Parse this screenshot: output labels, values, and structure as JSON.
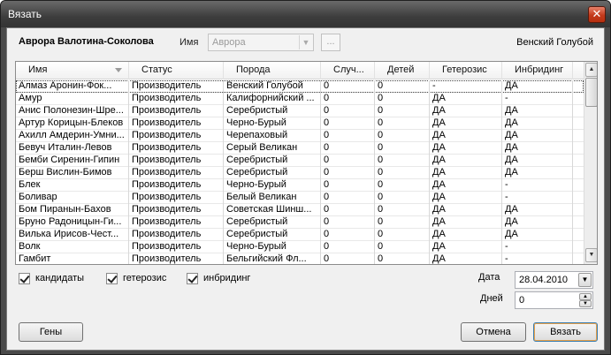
{
  "window": {
    "title": "Вязать",
    "close_symbol": "✕"
  },
  "header": {
    "producer_name": "Аврора Валотина-Соколова",
    "name_label": "Имя",
    "name_value": "Аврора",
    "browse_label": "...",
    "breed": "Венский Голубой"
  },
  "grid": {
    "columns": [
      "Имя",
      "Статус",
      "Порода",
      "Случ...",
      "Детей",
      "Гетерозис",
      "Инбридинг"
    ],
    "rows": [
      [
        "Алмаз Аронин-Фок...",
        "Производитель",
        "Венский Голубой",
        "0",
        "0",
        "-",
        "ДА"
      ],
      [
        "Амур",
        "Производитель",
        "Калифорнийский ...",
        "0",
        "0",
        "ДА",
        "-"
      ],
      [
        "Анис Полонезин-Шре...",
        "Производитель",
        "Серебристый",
        "0",
        "0",
        "ДА",
        "ДА"
      ],
      [
        "Артур Корицын-Блеков",
        "Производитель",
        "Черно-Бурый",
        "0",
        "0",
        "ДА",
        "ДА"
      ],
      [
        "Ахилл Амдерин-Умни...",
        "Производитель",
        "Черепаховый",
        "0",
        "0",
        "ДА",
        "ДА"
      ],
      [
        "Бевуч Италин-Левов",
        "Производитель",
        "Серый Великан",
        "0",
        "0",
        "ДА",
        "ДА"
      ],
      [
        "Бемби Сиренин-Гипин",
        "Производитель",
        "Серебристый",
        "0",
        "0",
        "ДА",
        "ДА"
      ],
      [
        "Берш Вислин-Бимов",
        "Производитель",
        "Серебристый",
        "0",
        "0",
        "ДА",
        "ДА"
      ],
      [
        "Блек",
        "Производитель",
        "Черно-Бурый",
        "0",
        "0",
        "ДА",
        "-"
      ],
      [
        "Боливар",
        "Производитель",
        "Белый Великан",
        "0",
        "0",
        "ДА",
        "-"
      ],
      [
        "Бом Пиранын-Бахов",
        "Производитель",
        "Советская Шинш...",
        "0",
        "0",
        "ДА",
        "ДА"
      ],
      [
        "Бруно Радоницын-Ги...",
        "Производитель",
        "Серебристый",
        "0",
        "0",
        "ДА",
        "ДА"
      ],
      [
        "Вилька Ирисов-Чест...",
        "Производитель",
        "Серебристый",
        "0",
        "0",
        "ДА",
        "ДА"
      ],
      [
        "Волк",
        "Производитель",
        "Черно-Бурый",
        "0",
        "0",
        "ДА",
        "-"
      ],
      [
        "Гамбит",
        "Производитель",
        "Бельгийский Фл...",
        "0",
        "0",
        "ДА",
        "-"
      ]
    ]
  },
  "filters": {
    "candidates": "кандидаты",
    "heterosis": "гетерозис",
    "inbreeding": "инбридинг"
  },
  "date": {
    "label": "Дата",
    "value": "28.04.2010"
  },
  "days": {
    "label": "Дней",
    "value": "0"
  },
  "buttons": {
    "genes": "Гены",
    "cancel": "Отмена",
    "mate": "Вязать"
  }
}
